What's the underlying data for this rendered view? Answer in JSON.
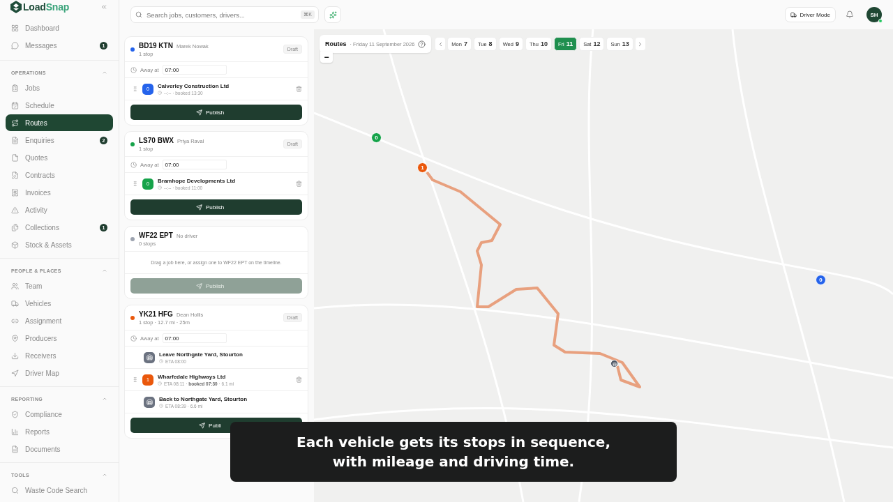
{
  "brand": {
    "name_dark": "Load",
    "name_light": "Snap"
  },
  "sidebar": {
    "top_items": [
      {
        "label": "Dashboard",
        "selected": false
      },
      {
        "label": "Messages",
        "badge": "1",
        "selected": false
      }
    ],
    "sections": [
      {
        "title": "OPERATIONS",
        "expanded": true,
        "items": [
          {
            "label": "Jobs",
            "selected": false
          },
          {
            "label": "Schedule",
            "selected": false
          },
          {
            "label": "Routes",
            "selected": true
          },
          {
            "label": "Enquiries",
            "badge": "2",
            "selected": false
          },
          {
            "label": "Quotes",
            "selected": false
          },
          {
            "label": "Contracts",
            "selected": false
          },
          {
            "label": "Invoices",
            "selected": false
          },
          {
            "label": "Activity",
            "selected": false
          },
          {
            "label": "Collections",
            "badge": "1",
            "selected": false
          },
          {
            "label": "Stock & Assets",
            "selected": false
          }
        ]
      },
      {
        "title": "PEOPLE & PLACES",
        "expanded": true,
        "items": [
          {
            "label": "Team",
            "selected": false
          },
          {
            "label": "Vehicles",
            "selected": false
          },
          {
            "label": "Assignment",
            "selected": false
          },
          {
            "label": "Producers",
            "selected": false
          },
          {
            "label": "Receivers",
            "selected": false
          },
          {
            "label": "Driver Map",
            "selected": false
          }
        ]
      },
      {
        "title": "REPORTING",
        "expanded": true,
        "items": [
          {
            "label": "Compliance",
            "selected": false
          },
          {
            "label": "Reports",
            "selected": false
          },
          {
            "label": "Documents",
            "selected": false
          }
        ]
      },
      {
        "title": "TOOLS",
        "expanded": true,
        "items": [
          {
            "label": "Waste Code Search",
            "selected": false
          }
        ]
      }
    ]
  },
  "topbar": {
    "search": {
      "placeholder": "Search jobs, customers, drivers...",
      "shortcut": "⌘K"
    },
    "driver_mode": "Driver Mode",
    "avatar": {
      "initials": "SH",
      "online": true
    }
  },
  "vehicles": [
    {
      "plate": "BD19 KTN",
      "driver": "Marek Nowak",
      "summary": "1 stop",
      "color": "#2563eb",
      "status": "Draft",
      "away_label": "Away at",
      "away_time": "07:00",
      "stops": [
        {
          "kind": "job",
          "number": "0",
          "color": "#2563eb",
          "name": "Calverley Construction Ltd",
          "meta": "--:-- · booked 13:30"
        }
      ],
      "publish": {
        "label": "Publish",
        "disabled": false
      }
    },
    {
      "plate": "LS70 BWX",
      "driver": "Priya Raval",
      "summary": "1 stop",
      "color": "#16a34a",
      "status": "Draft",
      "away_label": "Away at",
      "away_time": "07:00",
      "stops": [
        {
          "kind": "job",
          "number": "0",
          "color": "#16a34a",
          "name": "Bramhope Developments Ltd",
          "meta": "--:-- · booked 11:00"
        }
      ],
      "publish": {
        "label": "Publish",
        "disabled": false
      }
    },
    {
      "plate": "WF22 EPT",
      "driver": "No driver",
      "summary": "0 stops",
      "color": "#9ca3af",
      "empty_text": "Drag a job here, or assign one to WF22 EPT on the timeline.",
      "publish": {
        "label": "Publish",
        "disabled": true
      }
    },
    {
      "plate": "YK21 HFG",
      "driver": "Dean Hollis",
      "summary": "1 stop · 12.7 mi · 25m",
      "color": "#ea580c",
      "status": "Draft",
      "away_label": "Away at",
      "away_time": "07:00",
      "stops": [
        {
          "kind": "depot",
          "name": "Leave Northgate Yard, Stourton",
          "meta": "ETA 08:00"
        },
        {
          "kind": "job",
          "number": "1",
          "color": "#ea580c",
          "name": "Wharfedale Highways Ltd",
          "meta": "ETA 08:11 · **booked 07:30** · 6.1 mi"
        },
        {
          "kind": "depot",
          "name": "Back to Northgate Yard, Stourton",
          "meta": "ETA 08:39 · 6.6 mi"
        }
      ],
      "publish": {
        "label": "Publi",
        "disabled": false
      }
    }
  ],
  "map": {
    "title": "Routes",
    "date": "· Friday 11 September 2026",
    "zoom_out": "−",
    "days": [
      {
        "day": "Mon",
        "num": "7",
        "selected": false
      },
      {
        "day": "Tue",
        "num": "8",
        "selected": false
      },
      {
        "day": "Wed",
        "num": "9",
        "selected": false
      },
      {
        "day": "Thu",
        "num": "10",
        "selected": false
      },
      {
        "day": "Fri",
        "num": "11",
        "selected": true
      },
      {
        "day": "Sat",
        "num": "12",
        "selected": false
      },
      {
        "day": "Sun",
        "num": "13",
        "selected": false
      }
    ],
    "markers": [
      {
        "kind": "stop",
        "label": "0",
        "color": "#16a34a"
      },
      {
        "kind": "stop",
        "label": "1",
        "color": "#ea580c"
      },
      {
        "kind": "stop",
        "label": "0",
        "color": "#2563eb"
      },
      {
        "kind": "depot"
      }
    ]
  },
  "caption": {
    "lines": [
      "Each vehicle gets its stops in sequence,",
      "with mileage and driving time."
    ]
  }
}
